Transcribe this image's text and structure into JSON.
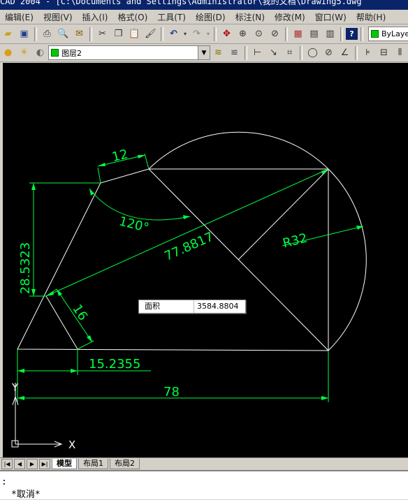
{
  "window": {
    "title": "CAD 2004 - [C:\\Documents and Settings\\Administrator\\我的文档\\Drawing5.dwg"
  },
  "menu": [
    "编辑(E)",
    "视图(V)",
    "插入(I)",
    "格式(O)",
    "工具(T)",
    "绘图(D)",
    "标注(N)",
    "修改(M)",
    "窗口(W)",
    "帮助(H)"
  ],
  "toolbar": {
    "color_value": "ByLayer",
    "layer_value": "图层2"
  },
  "drawing": {
    "dims": {
      "top_edge": "12",
      "left_vertical": "28.5323",
      "angle": "120°",
      "diagonal": "77.8817",
      "radius": "R32",
      "slant": "16",
      "bottom_left": "15.2355",
      "overall": "78"
    },
    "ucs": {
      "x_label": "X",
      "y_label": "Y"
    },
    "area_field": {
      "label": "面积",
      "value": "3584.8804"
    }
  },
  "layout_tabs": [
    "模型",
    "布局1",
    "布局2"
  ],
  "command": {
    "line1": ":",
    "line2": "*取消*"
  },
  "colors": {
    "geometry": "#ffffff",
    "dimension": "#00ff40",
    "canvas": "#000000"
  }
}
